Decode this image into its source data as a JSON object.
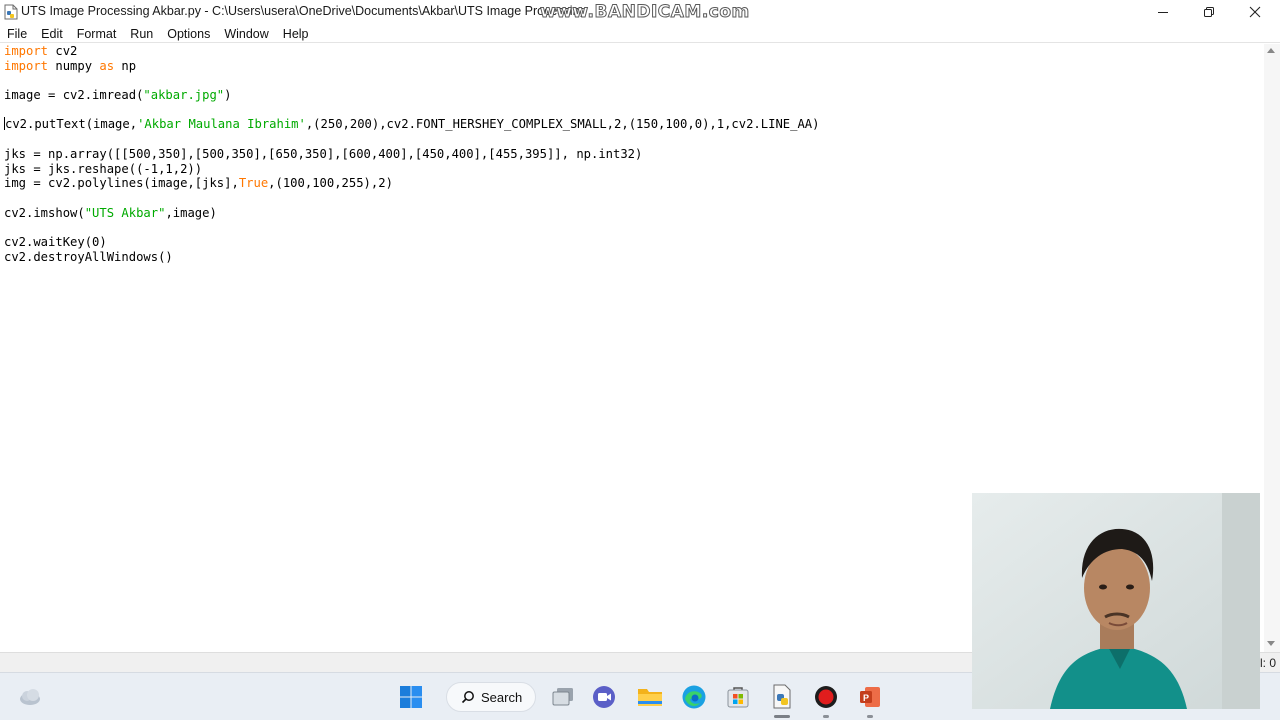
{
  "window": {
    "title": "UTS Image Processing Akbar.py - C:\\Users\\usera\\OneDrive\\Documents\\Akbar\\UTS Image Processing",
    "watermark": "www.BANDICAM.com",
    "minimize_icon": "minimize-icon",
    "maximize_icon": "restore-icon",
    "close_icon": "close-icon"
  },
  "menu": {
    "items": [
      {
        "label": "File"
      },
      {
        "label": "Edit"
      },
      {
        "label": "Format"
      },
      {
        "label": "Run"
      },
      {
        "label": "Options"
      },
      {
        "label": "Window"
      },
      {
        "label": "Help"
      }
    ]
  },
  "editor": {
    "lines": [
      [
        {
          "t": "kw",
          "v": "import"
        },
        {
          "t": "n",
          "v": " cv2"
        }
      ],
      [
        {
          "t": "kw",
          "v": "import"
        },
        {
          "t": "n",
          "v": " numpy "
        },
        {
          "t": "kw",
          "v": "as"
        },
        {
          "t": "n",
          "v": " np"
        }
      ],
      [],
      [
        {
          "t": "n",
          "v": "image = cv2.imread("
        },
        {
          "t": "str",
          "v": "\"akbar.jpg\""
        },
        {
          "t": "n",
          "v": ")"
        }
      ],
      [],
      [
        {
          "t": "caret",
          "v": ""
        },
        {
          "t": "n",
          "v": "cv2.putText(image,"
        },
        {
          "t": "str",
          "v": "'Akbar Maulana Ibrahim'"
        },
        {
          "t": "n",
          "v": ",(250,200),cv2.FONT_HERSHEY_COMPLEX_SMALL,2,(150,100,0),1,cv2.LINE_AA)"
        }
      ],
      [],
      [
        {
          "t": "n",
          "v": "jks = np.array([[500,350],[500,350],[650,350],[600,400],[450,400],[455,395]], np.int32)"
        }
      ],
      [
        {
          "t": "n",
          "v": "jks = jks.reshape((-1,1,2))"
        }
      ],
      [
        {
          "t": "n",
          "v": "img = cv2.polylines(image,[jks],"
        },
        {
          "t": "kw",
          "v": "True"
        },
        {
          "t": "n",
          "v": ",(100,100,255),2)"
        }
      ],
      [],
      [
        {
          "t": "n",
          "v": "cv2.imshow("
        },
        {
          "t": "str",
          "v": "\"UTS Akbar\""
        },
        {
          "t": "n",
          "v": ",image)"
        }
      ],
      [],
      [
        {
          "t": "n",
          "v": "cv2.waitKey(0)"
        }
      ],
      [
        {
          "t": "n",
          "v": "cv2.destroyAllWindows()"
        }
      ]
    ]
  },
  "statusbar": {
    "text": "l: 0"
  },
  "taskbar": {
    "search_label": "Search",
    "icons": [
      "weather-icon",
      "start-icon",
      "search-icon",
      "task-view-icon",
      "meet-icon",
      "file-explorer-icon",
      "edge-icon",
      "store-icon",
      "python-idle-icon",
      "bandicam-record-icon",
      "powerpoint-icon"
    ]
  },
  "colors": {
    "keyword": "#ff7700",
    "string": "#00aa00"
  }
}
